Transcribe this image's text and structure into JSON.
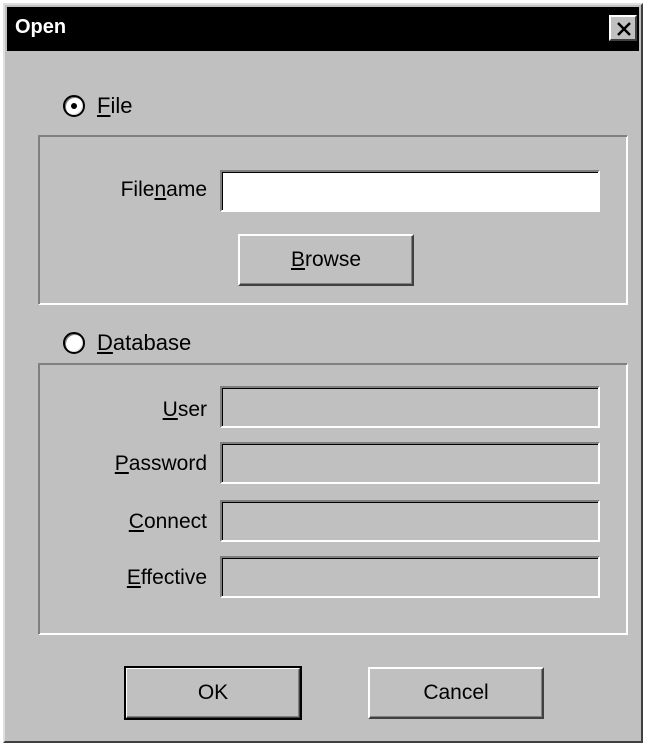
{
  "dialog": {
    "title": "Open",
    "close_icon": "close-icon"
  },
  "file_option": {
    "label_mnemonic": "F",
    "label_rest": "ile",
    "selected": true,
    "filename_label_pre": "File",
    "filename_label_mnemonic": "n",
    "filename_label_post": "ame",
    "filename_value": "",
    "browse_mnemonic": "B",
    "browse_rest": "rowse"
  },
  "database_option": {
    "label_mnemonic": "D",
    "label_rest": "atabase",
    "selected": false,
    "fields": [
      {
        "mnemonic": "U",
        "rest": "ser",
        "value": ""
      },
      {
        "mnemonic": "P",
        "rest": "assword",
        "value": ""
      },
      {
        "mnemonic": "C",
        "rest": "onnect",
        "value": ""
      },
      {
        "mnemonic": "E",
        "rest": "ffective",
        "value": ""
      }
    ]
  },
  "buttons": {
    "ok": "OK",
    "cancel": "Cancel"
  }
}
